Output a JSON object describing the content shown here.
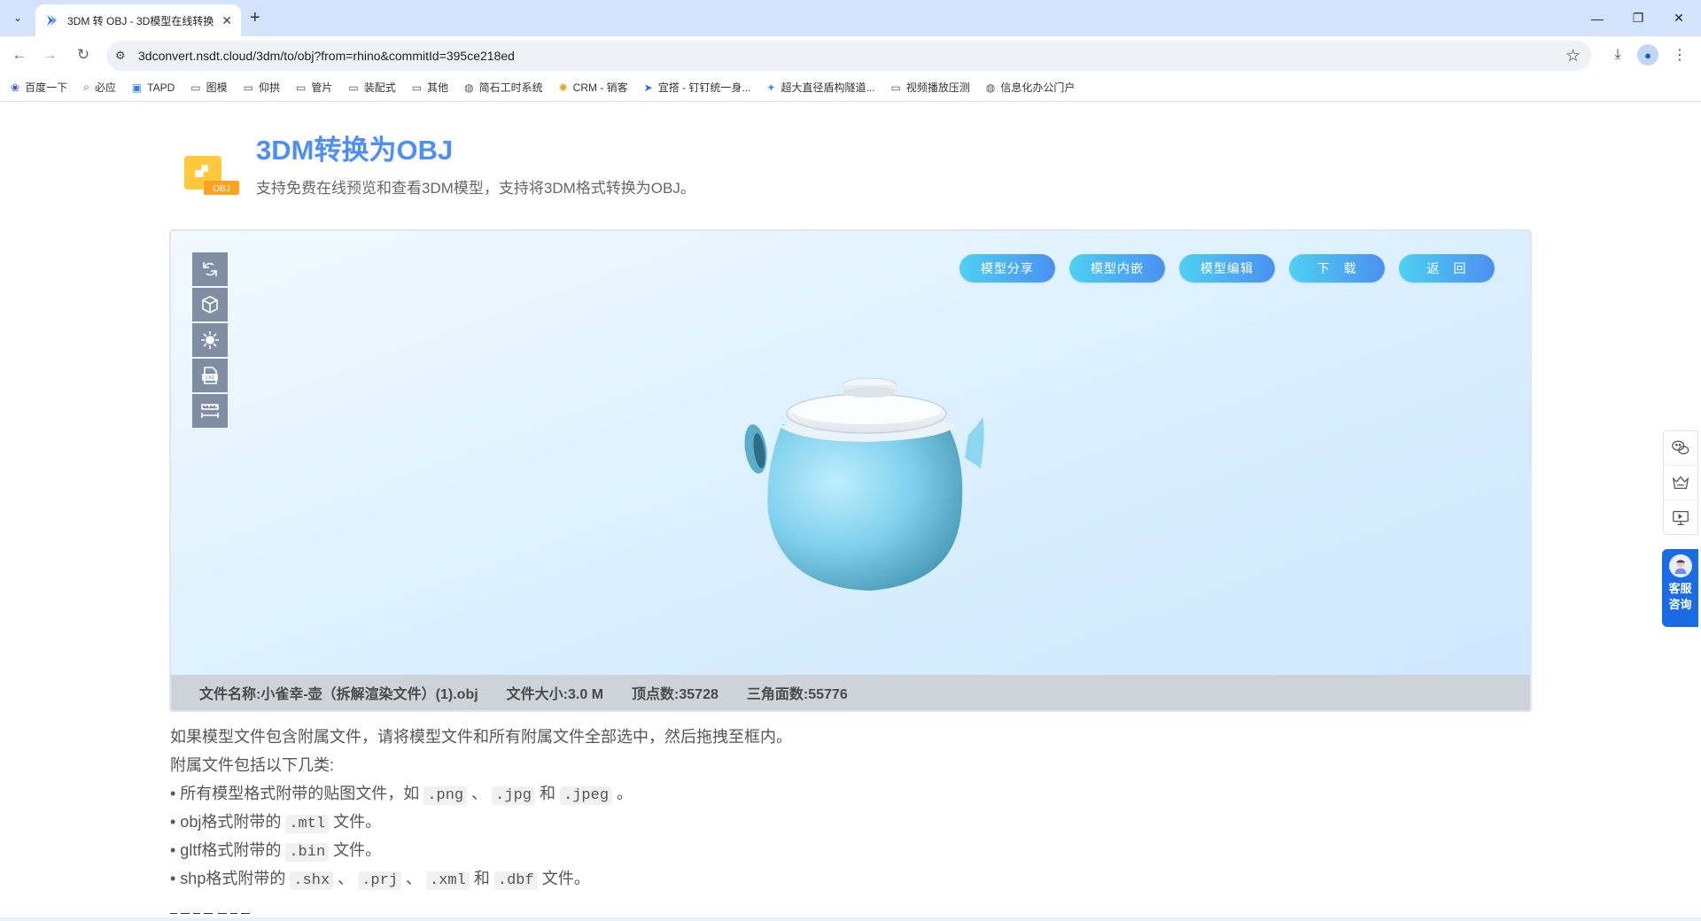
{
  "browser": {
    "tab_title": "3DM 转 OBJ - 3D模型在线转换",
    "url": "3dconvert.nsdt.cloud/3dm/to/obj?from=rhino&commitId=395ce218ed",
    "bookmarks": [
      {
        "icon": "baidu-icon",
        "label": "百度一下"
      },
      {
        "icon": "search-icon",
        "label": "必应"
      },
      {
        "icon": "tapd-icon",
        "label": "TAPD"
      },
      {
        "icon": "folder-icon",
        "label": "图模"
      },
      {
        "icon": "folder-icon",
        "label": "仰拱"
      },
      {
        "icon": "folder-icon",
        "label": "管片"
      },
      {
        "icon": "folder-icon",
        "label": "装配式"
      },
      {
        "icon": "folder-icon",
        "label": "其他"
      },
      {
        "icon": "globe-icon",
        "label": "简石工时系统"
      },
      {
        "icon": "crm-icon",
        "label": "CRM - 销客"
      },
      {
        "icon": "dingtalk-icon",
        "label": "宜搭 - 钉钉统一身..."
      },
      {
        "icon": "star-icon",
        "label": "超大直径盾构隧道..."
      },
      {
        "icon": "folder-icon",
        "label": "视频播放压测"
      },
      {
        "icon": "globe-icon",
        "label": "信息化办公门户"
      }
    ]
  },
  "header": {
    "title": "3DM转换为OBJ",
    "subtitle": "支持免费在线预览和查看3DM模型，支持将3DM格式转换为OBJ。",
    "logo_badge": "OBJ"
  },
  "viewer": {
    "actions": [
      "模型分享",
      "模型内嵌",
      "模型编辑",
      "下　载",
      "返　回"
    ],
    "info": {
      "name_label": "文件名称:",
      "name_value": "小雀幸-壶（拆解渲染文件）(1).obj",
      "size_label": "文件大小:",
      "size_value": "3.0 M",
      "vertex_label": "顶点数:",
      "vertex_value": "35728",
      "face_label": "三角面数:",
      "face_value": "55776"
    }
  },
  "notes": {
    "line1": "如果模型文件包含附属文件，请将模型文件和所有附属文件全部选中，然后拖拽至框内。",
    "line2": "附属文件包括以下几类:",
    "line3": {
      "prefix": "• 所有模型格式附带的贴图文件，如",
      "c1": ".png",
      "sep1": "、",
      "c2": ".jpg",
      "and": "和",
      "c3": ".jpeg",
      "end": "。"
    },
    "line4": {
      "prefix": "• obj格式附带的",
      "c1": ".mtl",
      "end": "文件。"
    },
    "line5": {
      "prefix": "• gltf格式附带的",
      "c1": ".bin",
      "end": "文件。"
    },
    "line6": {
      "prefix": "• shp格式附带的",
      "c1": ".shx",
      "sep1": "、",
      "c2": ".prj",
      "sep2": "、",
      "c3": ".xml",
      "and": "和",
      "c4": ".dbf",
      "end": "文件。"
    }
  },
  "float": {
    "service_label": "客服咨询"
  },
  "colors": {
    "brand_blue": "#4e8ef5",
    "button_gradient_start": "#4fd1f2",
    "button_gradient_end": "#4a90f2",
    "teapot": "#7fd0ec",
    "service": "#1b6ae6"
  }
}
